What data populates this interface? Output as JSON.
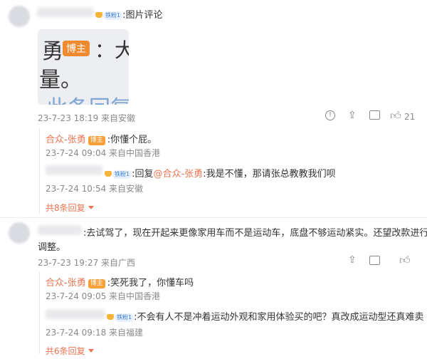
{
  "comment1": {
    "badge": "铁粉1",
    "text": ":图片评论",
    "image_text": {
      "line1": "勇",
      "tag": "博主",
      "line1_after": "：大",
      "line2": "量。",
      "line3": "此条回复"
    },
    "time_loc": "23-7-23 18:19 来自安徽",
    "like_count": "21",
    "replies": [
      {
        "name": "合众-张勇",
        "badge": "博主",
        "text": ":你懂个屁。",
        "time_loc": "23-7-24 09:04 来自中国香港"
      },
      {
        "badge": "铁粉1",
        "text_prefix": ":回复",
        "mention": "@合众-张勇",
        "text": ":我是不懂，那请张总教教我们呗",
        "time_loc": "23-7-24 10:54 来自安徽"
      }
    ],
    "more_replies": "共8条回复"
  },
  "comment2": {
    "text_line1": ":去试驾了，现在开起来更像家用车而不是运动车，底盘不够运动紧实。还望改款进行",
    "text_line2": "调整。",
    "time_loc": "23-7-23 19:27 来自广西",
    "replies": [
      {
        "name": "合众-张勇",
        "badge": "博主",
        "text": ":笑死我了，你懂车吗",
        "time_loc": "23-7-24 09:05 来自中国香港"
      },
      {
        "badge": "铁粉1",
        "text": ":不会有人不是冲着运动外观和家用体验买的吧？真改成运动型还真难卖",
        "time_loc": "23-7-24 09:18 来自福建"
      }
    ],
    "more_replies": "共6条回复"
  }
}
